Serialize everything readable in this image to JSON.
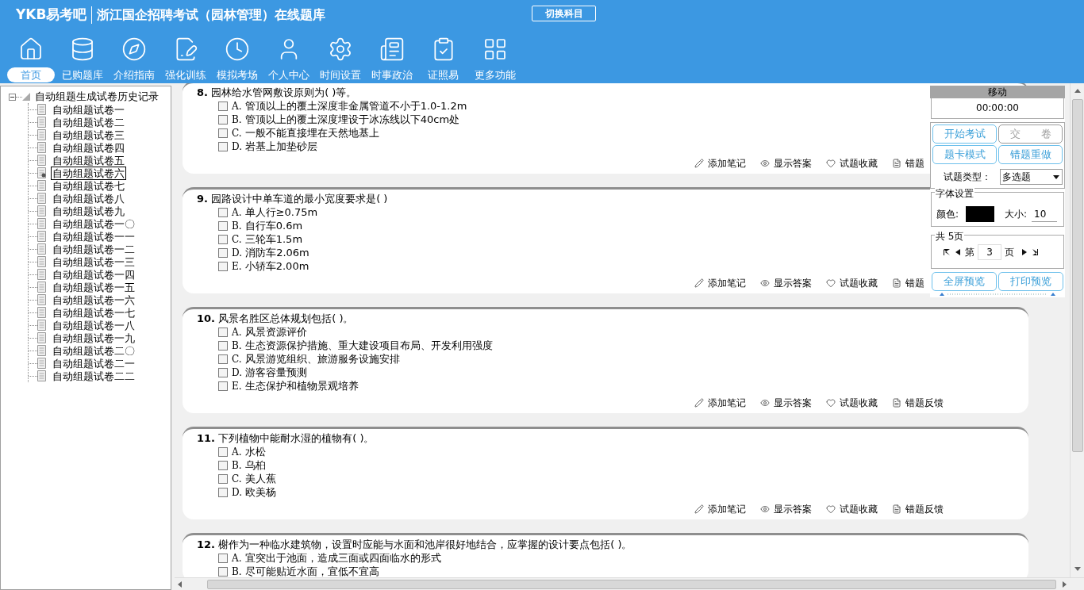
{
  "header": {
    "logo": "YKB易考吧",
    "title": "浙江国企招聘考试（园林管理）在线题库",
    "switch_button": "切换科目"
  },
  "nav": [
    {
      "label": "首页",
      "selected": true
    },
    {
      "label": "已购题库",
      "selected": false
    },
    {
      "label": "介绍指南",
      "selected": false
    },
    {
      "label": "强化训练",
      "selected": false
    },
    {
      "label": "模拟考场",
      "selected": false
    },
    {
      "label": "个人中心",
      "selected": false
    },
    {
      "label": "时间设置",
      "selected": false
    },
    {
      "label": "时事政治",
      "selected": false
    },
    {
      "label": "证照易",
      "selected": false
    },
    {
      "label": "更多功能",
      "selected": false
    }
  ],
  "tree": {
    "root": "自动组题生成试卷历史记录",
    "expanded": true,
    "children": [
      {
        "label": "自动组题试卷一",
        "selected": false
      },
      {
        "label": "自动组题试卷二",
        "selected": false
      },
      {
        "label": "自动组题试卷三",
        "selected": false
      },
      {
        "label": "自动组题试卷四",
        "selected": false
      },
      {
        "label": "自动组题试卷五",
        "selected": false
      },
      {
        "label": "自动组题试卷六",
        "selected": true
      },
      {
        "label": "自动组题试卷七",
        "selected": false
      },
      {
        "label": "自动组题试卷八",
        "selected": false
      },
      {
        "label": "自动组题试卷九",
        "selected": false
      },
      {
        "label": "自动组题试卷一〇",
        "selected": false
      },
      {
        "label": "自动组题试卷一一",
        "selected": false
      },
      {
        "label": "自动组题试卷一二",
        "selected": false
      },
      {
        "label": "自动组题试卷一三",
        "selected": false
      },
      {
        "label": "自动组题试卷一四",
        "selected": false
      },
      {
        "label": "自动组题试卷一五",
        "selected": false
      },
      {
        "label": "自动组题试卷一六",
        "selected": false
      },
      {
        "label": "自动组题试卷一七",
        "selected": false
      },
      {
        "label": "自动组题试卷一八",
        "selected": false
      },
      {
        "label": "自动组题试卷一九",
        "selected": false
      },
      {
        "label": "自动组题试卷二〇",
        "selected": false
      },
      {
        "label": "自动组题试卷二一",
        "selected": false
      },
      {
        "label": "自动组题试卷二二",
        "selected": false
      }
    ]
  },
  "questions": [
    {
      "number": "8.",
      "text": "园林给水管网敷设原则为( )等。",
      "options": [
        {
          "letter": "A.",
          "text": "管顶以上的覆土深度非金属管道不小于1.0-1.2m",
          "checked": false
        },
        {
          "letter": "B.",
          "text": "管顶以上的覆土深度埋设于冰冻线以下40cm处",
          "checked": false
        },
        {
          "letter": "C.",
          "text": "一般不能直接埋在天然地基上",
          "checked": false
        },
        {
          "letter": "D.",
          "text": "岩基上加垫砂层",
          "checked": false
        }
      ],
      "actions": [
        {
          "kind": "note",
          "label": "添加笔记"
        },
        {
          "kind": "answer",
          "label": "显示答案"
        },
        {
          "kind": "favorite",
          "label": "试题收藏"
        },
        {
          "kind": "feedback",
          "label": "错题"
        }
      ]
    },
    {
      "number": "9.",
      "text": "园路设计中单车道的最小宽度要求是( )",
      "options": [
        {
          "letter": "A.",
          "text": "单人行≥0.75m",
          "checked": false
        },
        {
          "letter": "B.",
          "text": "自行车0.6m",
          "checked": false
        },
        {
          "letter": "C.",
          "text": "三轮车1.5m",
          "checked": false
        },
        {
          "letter": "D.",
          "text": "消防车2.06m",
          "checked": false
        },
        {
          "letter": "E.",
          "text": "小轿车2.00m",
          "checked": false
        }
      ],
      "actions": [
        {
          "kind": "note",
          "label": "添加笔记"
        },
        {
          "kind": "answer",
          "label": "显示答案"
        },
        {
          "kind": "favorite",
          "label": "试题收藏"
        },
        {
          "kind": "feedback",
          "label": "错题"
        }
      ]
    },
    {
      "number": "10.",
      "text": "风景名胜区总体规划包括( )。",
      "options": [
        {
          "letter": "A.",
          "text": "风景资源评价",
          "checked": false
        },
        {
          "letter": "B.",
          "text": "生态资源保护措施、重大建设项目布局、开发利用强度",
          "checked": false
        },
        {
          "letter": "C.",
          "text": "风景游览组织、旅游服务设施安排",
          "checked": false
        },
        {
          "letter": "D.",
          "text": "游客容量预测",
          "checked": false
        },
        {
          "letter": "E.",
          "text": "生态保护和植物景观培养",
          "checked": false
        }
      ],
      "actions": [
        {
          "kind": "note",
          "label": "添加笔记"
        },
        {
          "kind": "answer",
          "label": "显示答案"
        },
        {
          "kind": "favorite",
          "label": "试题收藏"
        },
        {
          "kind": "feedback",
          "label": "错题反馈"
        }
      ]
    },
    {
      "number": "11.",
      "text": "下列植物中能耐水湿的植物有( )。",
      "options": [
        {
          "letter": "A.",
          "text": "水松",
          "checked": false
        },
        {
          "letter": "B.",
          "text": "乌桕",
          "checked": false
        },
        {
          "letter": "C.",
          "text": "美人蕉",
          "checked": false
        },
        {
          "letter": "D.",
          "text": "欧美杨",
          "checked": false
        }
      ],
      "actions": [
        {
          "kind": "note",
          "label": "添加笔记"
        },
        {
          "kind": "answer",
          "label": "显示答案"
        },
        {
          "kind": "favorite",
          "label": "试题收藏"
        },
        {
          "kind": "feedback",
          "label": "错题反馈"
        }
      ]
    },
    {
      "number": "12.",
      "text": "榭作为一种临水建筑物，设置时应能与水面和池岸很好地结合，应掌握的设计要点包括( )。",
      "options": [
        {
          "letter": "A.",
          "text": "宜突出于池面，造成三面或四面临水的形式",
          "checked": false
        },
        {
          "letter": "B.",
          "text": "尽可能贴近水面，宜低不宜高",
          "checked": false
        }
      ]
    }
  ],
  "panel": {
    "title": "移动",
    "timer": "00:00:00",
    "buttons": [
      {
        "label": "开始考试",
        "disabled": false
      },
      {
        "label": "交　　卷",
        "disabled": true
      },
      {
        "label": "题卡模式",
        "disabled": false
      },
      {
        "label": "错题重做",
        "disabled": false
      }
    ],
    "type_label": "试题类型：",
    "type_value": "多选题",
    "font_group": "字体设置",
    "color_label": "颜色:",
    "color": "#000000",
    "size_label": "大小:",
    "size_value": "10",
    "page_group": "共 5页",
    "page_prefix": "第",
    "page_value": "3",
    "page_suffix": "页",
    "bottom_buttons": [
      {
        "label": "全屏预览",
        "disabled": false
      },
      {
        "label": "打印预览",
        "disabled": false
      }
    ]
  }
}
